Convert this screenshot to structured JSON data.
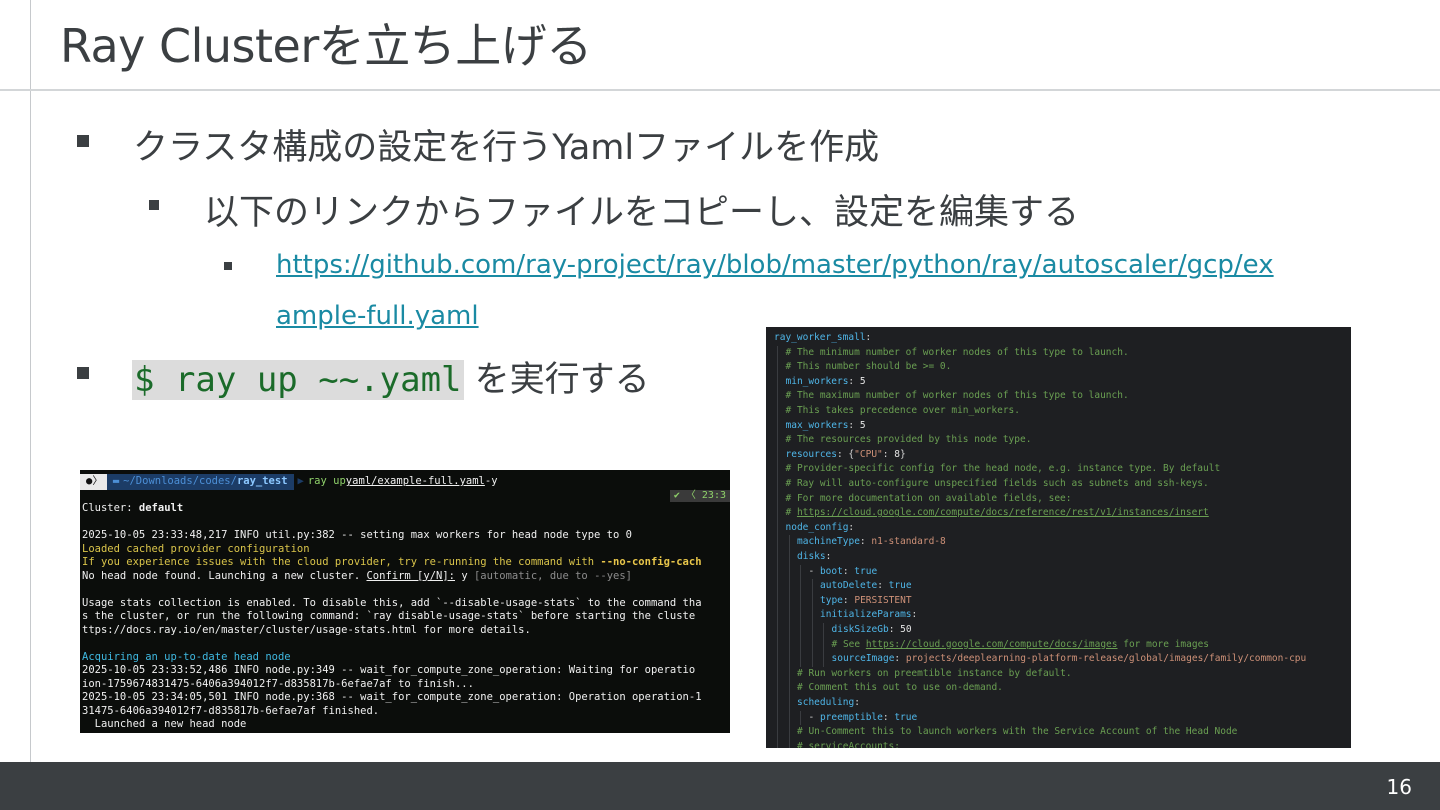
{
  "slide": {
    "title": "Ray Clusterを立ち上げる",
    "page_number": "16",
    "bullets": {
      "b1": "クラスタ構成の設定を行うYamlファイルを作成",
      "b2": "以下のリンクからファイルをコピーし、設定を編集する",
      "link_line1": "https://github.com/ray-project/ray/blob/master/python/ray/autoscaler/gcp/ex",
      "link_line2": "ample-full.yaml",
      "cmd_code": "$ ray up ~~.yaml",
      "cmd_suffix": "を実行する"
    }
  },
  "terminal": {
    "path_prefix": "~/Downloads/codes/",
    "path_dir": "ray_test",
    "command_name": "ray up ",
    "command_file": "yaml/example-full.yaml",
    "command_flag": " -y",
    "right_prompt": "✔ 〈 23:3",
    "lines": [
      {
        "text": "Cluster: ",
        "bold": "default",
        "cls": ""
      },
      {
        "text": "",
        "cls": ""
      },
      {
        "text": "2025-10-05 23:33:48,217 INFO util.py:382 -- setting max workers for head node type to 0",
        "cls": ""
      },
      {
        "text": "Loaded cached provider configuration",
        "cls": "t-yellow"
      },
      {
        "text": "If you experience issues with the cloud provider, try re-running the command with ",
        "flag": "--no-config-cach",
        "cls": "t-yellow"
      },
      {
        "text": "No head node found. Launching a new cluster. ",
        "ul": "Confirm [y/N]:",
        "after": " y ",
        "gray": "[automatic, due to --yes]",
        "cls": ""
      },
      {
        "text": "",
        "cls": ""
      },
      {
        "text": "Usage stats collection is enabled. To disable this, add `--disable-usage-stats` to the command tha",
        "cls": ""
      },
      {
        "text": "s the cluster, or run the following command: `ray disable-usage-stats` before starting the cluste",
        "cls": ""
      },
      {
        "text": "ttps://docs.ray.io/en/master/cluster/usage-stats.html for more details.",
        "cls": ""
      },
      {
        "text": "",
        "cls": ""
      },
      {
        "text": "Acquiring an up-to-date head node",
        "cls": "t-cyan"
      },
      {
        "text": "2025-10-05 23:33:52,486 INFO node.py:349 -- wait_for_compute_zone_operation: Waiting for operatio",
        "cls": ""
      },
      {
        "text": "ion-1759674831475-6406a394012f7-d835817b-6efae7af to finish...",
        "cls": ""
      },
      {
        "text": "2025-10-05 23:34:05,501 INFO node.py:368 -- wait_for_compute_zone_operation: Operation operation-1",
        "cls": ""
      },
      {
        "text": "31475-6406a394012f7-d835817b-6efae7af finished.",
        "cls": ""
      },
      {
        "text": "  Launched a new head node",
        "cls": ""
      }
    ]
  },
  "editor": {
    "lines": [
      {
        "indent": 0,
        "parts": [
          [
            "key",
            "ray_worker_small"
          ],
          [
            "punc",
            ":"
          ]
        ]
      },
      {
        "indent": 1,
        "parts": [
          [
            "com",
            "# The minimum number of worker nodes of this type to launch."
          ]
        ]
      },
      {
        "indent": 1,
        "parts": [
          [
            "com",
            "# This number should be >= 0."
          ]
        ]
      },
      {
        "indent": 1,
        "parts": [
          [
            "key",
            "min_workers"
          ],
          [
            "punc",
            ": "
          ],
          [
            "num",
            "5"
          ]
        ]
      },
      {
        "indent": 1,
        "parts": [
          [
            "com",
            "# The maximum number of worker nodes of this type to launch."
          ]
        ]
      },
      {
        "indent": 1,
        "parts": [
          [
            "com",
            "# This takes precedence over min_workers."
          ]
        ]
      },
      {
        "indent": 1,
        "parts": [
          [
            "key",
            "max_workers"
          ],
          [
            "punc",
            ": "
          ],
          [
            "num",
            "5"
          ]
        ]
      },
      {
        "indent": 1,
        "parts": [
          [
            "com",
            "# The resources provided by this node type."
          ]
        ]
      },
      {
        "indent": 1,
        "parts": [
          [
            "key",
            "resources"
          ],
          [
            "punc",
            ": {"
          ],
          [
            "str",
            "\"CPU\""
          ],
          [
            "punc",
            ": "
          ],
          [
            "num",
            "8"
          ],
          [
            "punc",
            "}"
          ]
        ]
      },
      {
        "indent": 1,
        "parts": [
          [
            "com",
            "# Provider-specific config for the head node, e.g. instance type. By default"
          ]
        ]
      },
      {
        "indent": 1,
        "parts": [
          [
            "com",
            "# Ray will auto-configure unspecified fields such as subnets and ssh-keys."
          ]
        ]
      },
      {
        "indent": 1,
        "parts": [
          [
            "com",
            "# For more documentation on available fields, see:"
          ]
        ]
      },
      {
        "indent": 1,
        "parts": [
          [
            "com",
            "# "
          ],
          [
            "link",
            "https://cloud.google.com/compute/docs/reference/rest/v1/instances/insert"
          ]
        ]
      },
      {
        "indent": 1,
        "parts": [
          [
            "key",
            "node_config"
          ],
          [
            "punc",
            ":"
          ]
        ]
      },
      {
        "indent": 2,
        "parts": [
          [
            "key",
            "machineType"
          ],
          [
            "punc",
            ": "
          ],
          [
            "str",
            "n1-standard-8"
          ]
        ]
      },
      {
        "indent": 2,
        "parts": [
          [
            "key",
            "disks"
          ],
          [
            "punc",
            ":"
          ]
        ]
      },
      {
        "indent": 3,
        "parts": [
          [
            "punc",
            "- "
          ],
          [
            "key",
            "boot"
          ],
          [
            "punc",
            ": "
          ],
          [
            "bool",
            "true"
          ]
        ]
      },
      {
        "indent": 4,
        "parts": [
          [
            "key",
            "autoDelete"
          ],
          [
            "punc",
            ": "
          ],
          [
            "bool",
            "true"
          ]
        ]
      },
      {
        "indent": 4,
        "parts": [
          [
            "key",
            "type"
          ],
          [
            "punc",
            ": "
          ],
          [
            "str",
            "PERSISTENT"
          ]
        ]
      },
      {
        "indent": 4,
        "parts": [
          [
            "key",
            "initializeParams"
          ],
          [
            "punc",
            ":"
          ]
        ]
      },
      {
        "indent": 5,
        "parts": [
          [
            "key",
            "diskSizeGb"
          ],
          [
            "punc",
            ": "
          ],
          [
            "num",
            "50"
          ]
        ]
      },
      {
        "indent": 5,
        "parts": [
          [
            "com",
            "# See "
          ],
          [
            "link",
            "https://cloud.google.com/compute/docs/images"
          ],
          [
            "com",
            " for more images"
          ]
        ]
      },
      {
        "indent": 5,
        "parts": [
          [
            "key",
            "sourceImage"
          ],
          [
            "punc",
            ": "
          ],
          [
            "str",
            "projects/deeplearning-platform-release/global/images/family/common-cpu"
          ]
        ]
      },
      {
        "indent": 2,
        "parts": [
          [
            "com",
            "# Run workers on preemtible instance by default."
          ]
        ]
      },
      {
        "indent": 2,
        "parts": [
          [
            "com",
            "# Comment this out to use on-demand."
          ]
        ]
      },
      {
        "indent": 2,
        "parts": [
          [
            "key",
            "scheduling"
          ],
          [
            "punc",
            ":"
          ]
        ]
      },
      {
        "indent": 3,
        "parts": [
          [
            "punc",
            "- "
          ],
          [
            "key",
            "preemptible"
          ],
          [
            "punc",
            ": "
          ],
          [
            "bool",
            "true"
          ]
        ]
      },
      {
        "indent": 2,
        "parts": [
          [
            "com",
            "# Un-Comment this to launch workers with the Service Account of the Head Node"
          ]
        ]
      },
      {
        "indent": 2,
        "parts": [
          [
            "com",
            "# serviceAccounts:"
          ]
        ]
      }
    ]
  }
}
